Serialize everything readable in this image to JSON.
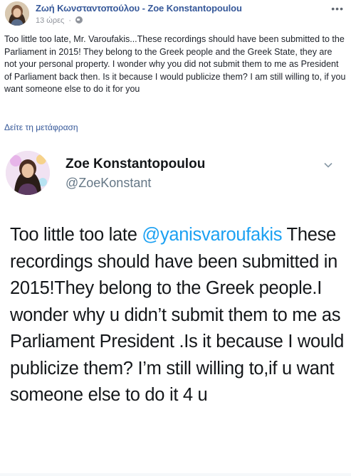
{
  "post": {
    "page_name": "Ζωή Κωνσταντοπούλου - Zoe Konstantopoulou",
    "time": "13 ώρες",
    "more_label": "•••",
    "text": "Too little too late, Mr. Varoufakis...These recordings should have been submitted to the Parliament in 2015! They belong to the Greek people and the Greek State, they are not your personal property. I wonder why you did not submit them to me as President of Parliament back then. Is it because I would publicize them? I am still willing to, if you want someone else to do it for you",
    "translate_label": "Δείτε τη μετάφραση"
  },
  "tweet": {
    "name": "Zoe Konstantopoulou",
    "handle": "@ZoeKonstant",
    "text_before_mention": "Too little too late ",
    "mention": "@yanisvaroufakis",
    "text_after_mention": " These recordings should have been submitted in 2015!They belong to the Greek people.I wonder why u didn’t submit them to me as Parliament President .Is it because I would publicize them? I’m still willing to,if u want someone else to do it 4 u"
  },
  "colors": {
    "link_blue": "#365899",
    "twitter_blue": "#1da1f2",
    "meta_gray": "#90949c"
  },
  "icons": [
    "globe-icon",
    "more-icon",
    "chevron-down-icon",
    "avatar"
  ]
}
